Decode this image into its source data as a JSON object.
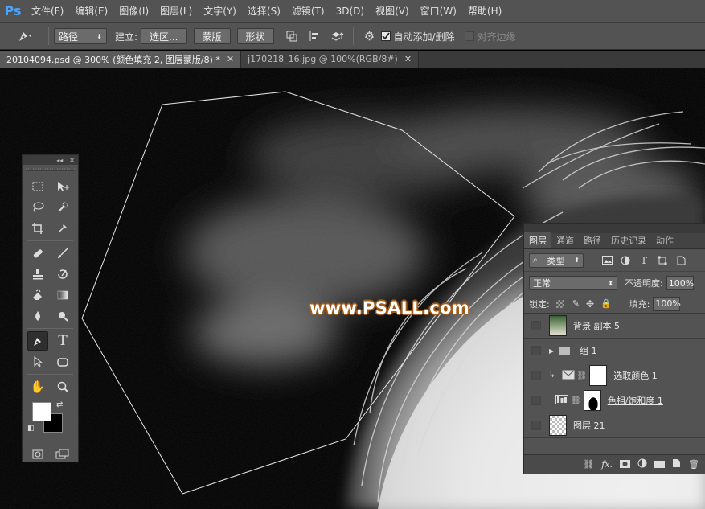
{
  "app": {
    "logo": "Ps"
  },
  "menu": [
    "文件(F)",
    "编辑(E)",
    "图像(I)",
    "图层(L)",
    "文字(Y)",
    "选择(S)",
    "滤镜(T)",
    "3D(D)",
    "视图(V)",
    "窗口(W)",
    "帮助(H)"
  ],
  "options": {
    "mode_value": "路径",
    "make_label": "建立:",
    "selection_btn": "选区...",
    "mask_btn": "蒙版",
    "shape_btn": "形状",
    "auto_add_label": "自动添加/删除",
    "align_edges_label": "对齐边缘"
  },
  "tabs": [
    {
      "label": "20104094.psd @ 300% (颜色填充 2, 图层蒙版/8) *"
    },
    {
      "label": "j170218_16.jpg @ 100%(RGB/8#)"
    }
  ],
  "watermark": "www.PSALL.com",
  "layers_panel": {
    "tabs": [
      "图层",
      "通道",
      "路径",
      "历史记录",
      "动作"
    ],
    "filter_value": "类型",
    "blend_mode": "正常",
    "opacity_label": "不透明度:",
    "opacity_value": "100%",
    "lock_label": "锁定:",
    "fill_label": "填充:",
    "fill_value": "100%",
    "layers": [
      {
        "name": "背景 副本 5"
      },
      {
        "name": "组 1"
      },
      {
        "name": "选取颜色 1"
      },
      {
        "name": "色相/饱和度 1"
      },
      {
        "name": "图层 21"
      }
    ]
  },
  "colors": {
    "accent": "#4aa3ff",
    "ui_bg": "#535353",
    "watermark_outline": "#a05a1a"
  }
}
